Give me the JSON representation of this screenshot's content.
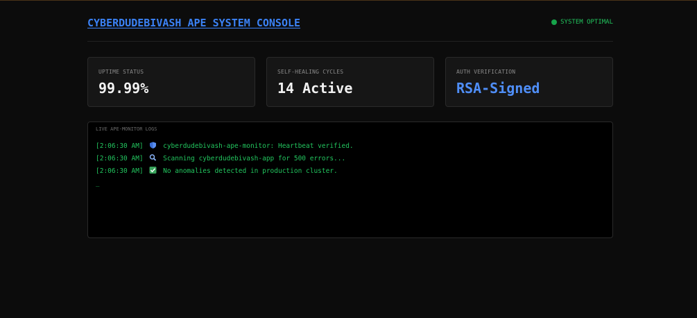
{
  "header": {
    "title": "CYBERDUDEBIVASH APE SYSTEM CONSOLE",
    "status_text": "SYSTEM OPTIMAL"
  },
  "cards": [
    {
      "label": "UPTIME STATUS",
      "value": "99.99%"
    },
    {
      "label": "SELF-HEALING CYCLES",
      "value": "14 Active"
    },
    {
      "label": "AUTH VERIFICATION",
      "value": "RSA-Signed"
    }
  ],
  "logs": {
    "label": "LIVE APE-MONITOR LOGS",
    "lines": [
      {
        "time": "[2:06:30 AM]",
        "icon": "shield-icon",
        "text": "cyberdudebivash-ape-monitor: Heartbeat verified."
      },
      {
        "time": "[2:06:30 AM]",
        "icon": "magnifier-icon",
        "text": "Scanning cyberdudebivash-app for 500 errors..."
      },
      {
        "time": "[2:06:30 AM]",
        "icon": "check-box-icon",
        "text": "No anomalies detected in production cluster."
      }
    ],
    "cursor": "_"
  },
  "colors": {
    "accent": "#3b82f6",
    "status": "#22c55e",
    "background": "#0c0c0c"
  }
}
